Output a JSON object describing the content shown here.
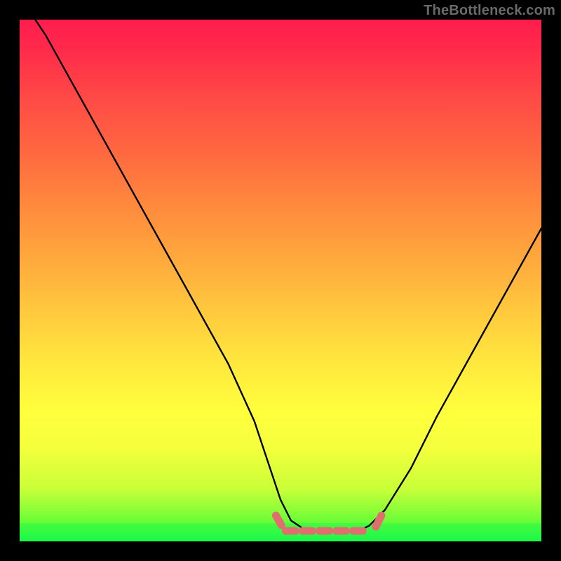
{
  "watermark": "TheBottleneck.com",
  "chart_data": {
    "type": "line",
    "title": "",
    "xlabel": "",
    "ylabel": "",
    "xlim": [
      0,
      100
    ],
    "ylim": [
      0,
      100
    ],
    "grid": false,
    "series": [
      {
        "name": "curve",
        "x": [
          3,
          5,
          10,
          15,
          20,
          25,
          30,
          35,
          40,
          45,
          48,
          50,
          52,
          55,
          58,
          60,
          63,
          65,
          67,
          70,
          75,
          80,
          85,
          90,
          95,
          100
        ],
        "y": [
          100,
          97,
          88,
          79,
          70,
          61,
          52,
          43,
          34,
          23,
          14,
          8,
          4,
          2,
          2,
          2,
          2,
          2,
          3,
          6,
          14,
          24,
          33,
          42,
          51,
          60
        ],
        "color": "#000000"
      }
    ],
    "flat_bottom_marker": {
      "x_start": 51,
      "x_end": 68,
      "y": 2,
      "color": "#e57373",
      "style": "dashed-thick"
    },
    "background_gradient": {
      "type": "vertical",
      "stops": [
        {
          "pos": 0.0,
          "color": "#2cfb49"
        },
        {
          "pos": 0.1,
          "color": "#c8ff38"
        },
        {
          "pos": 0.25,
          "color": "#ffff3d"
        },
        {
          "pos": 0.45,
          "color": "#ffc63d"
        },
        {
          "pos": 0.65,
          "color": "#ff873d"
        },
        {
          "pos": 0.85,
          "color": "#ff4a46"
        },
        {
          "pos": 1.0,
          "color": "#ff1d4e"
        }
      ]
    }
  }
}
